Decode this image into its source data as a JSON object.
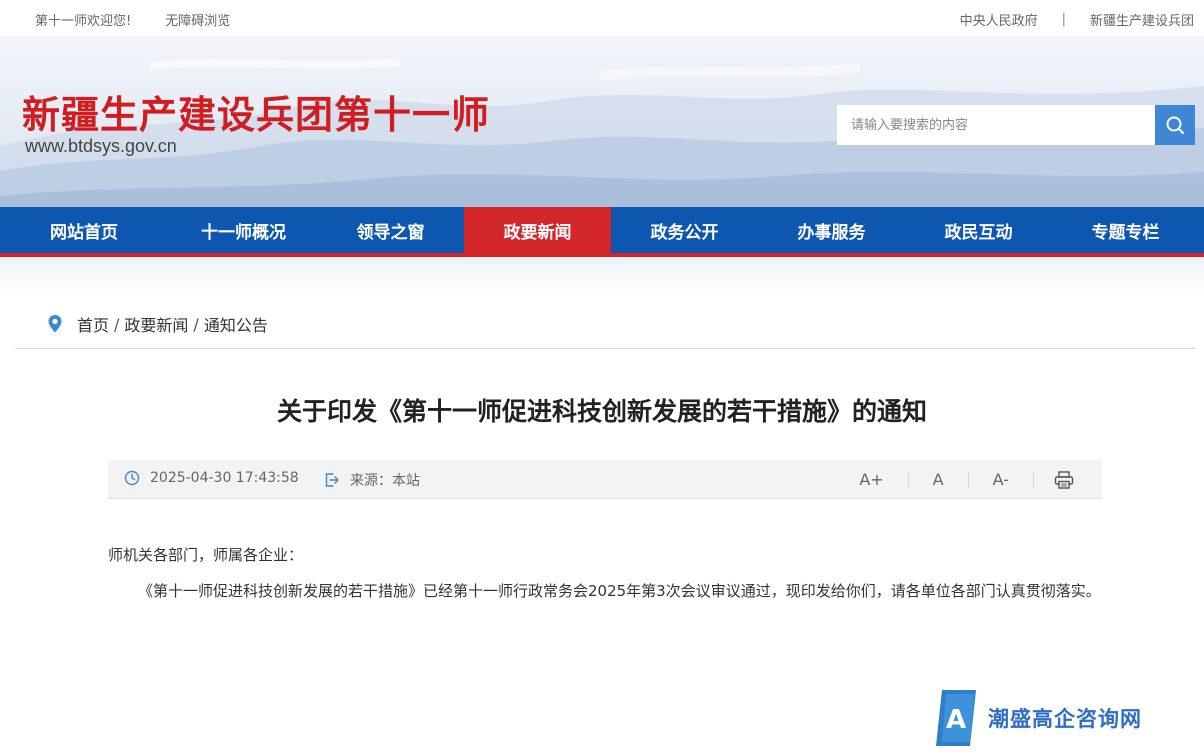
{
  "topbar": {
    "welcome": "第十一师欢迎您!",
    "accessible": "无障碍浏览",
    "link_gov": "中央人民政府",
    "separator": "|",
    "link_corps": "新疆生产建设兵团"
  },
  "header": {
    "site_title": "新疆生产建设兵团第十一师",
    "site_url": "www.btdsys.gov.cn",
    "search_placeholder": "请输入要搜索的内容",
    "search_icon": "search-icon"
  },
  "nav": {
    "items": [
      {
        "label": "网站首页"
      },
      {
        "label": "十一师概况"
      },
      {
        "label": "领导之窗"
      },
      {
        "label": "政要新闻"
      },
      {
        "label": "政务公开"
      },
      {
        "label": "办事服务"
      },
      {
        "label": "政民互动"
      },
      {
        "label": "专题专栏"
      }
    ],
    "active_index": 3
  },
  "breadcrumb": {
    "icon": "location-pin-icon",
    "items": [
      "首页",
      "政要新闻",
      "通知公告"
    ],
    "separator": "/"
  },
  "article": {
    "title": "关于印发《第十一师促进科技创新发展的若干措施》的通知",
    "datetime": "2025-04-30 17:43:58",
    "source_label": "来源：",
    "source_value": "本站",
    "font_larger": "A+",
    "font_normal": "A",
    "font_smaller": "A-",
    "print_icon": "printer-icon",
    "salutation": "师机关各部门，师属各企业：",
    "body": "《第十一师促进科技创新发展的若干措施》已经第十一师行政常务会2025年第3次会议审议通过，现印发给你们，请各单位各部门认真贯彻落实。"
  },
  "watermark": {
    "logo_letter": "A",
    "text": "潮盛高企咨询网"
  },
  "colors": {
    "brand_red": "#d21d20",
    "nav_blue": "#0e57b0",
    "nav_active": "#d3262b",
    "search_button": "#3f86d4",
    "watermark_blue": "#2f6ec4"
  }
}
